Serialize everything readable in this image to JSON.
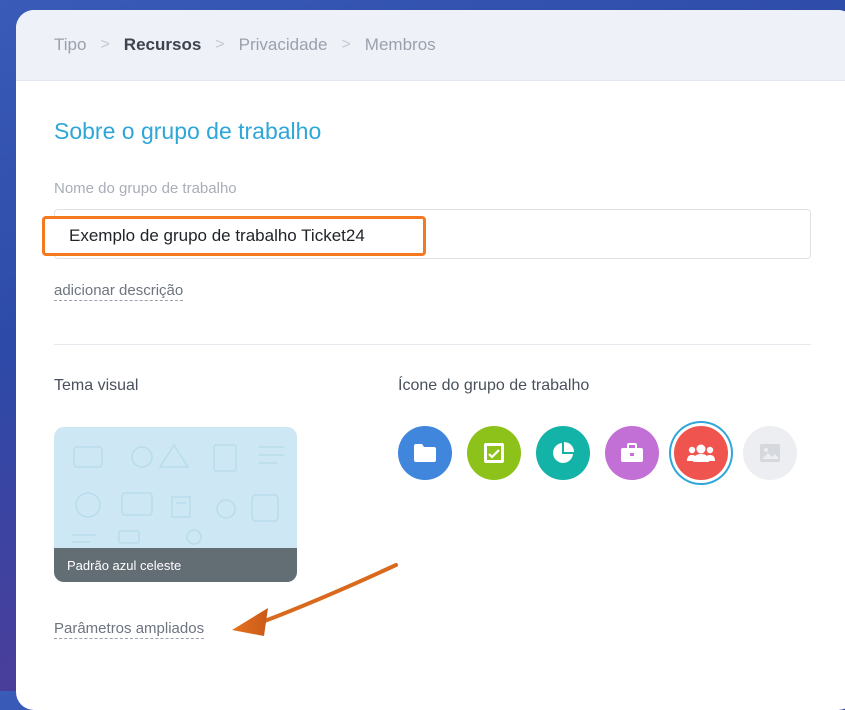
{
  "breadcrumb": [
    {
      "label": "Tipo",
      "active": false
    },
    {
      "label": "Recursos",
      "active": true
    },
    {
      "label": "Privacidade",
      "active": false
    },
    {
      "label": "Membros",
      "active": false
    }
  ],
  "breadcrumb_separator": ">",
  "form": {
    "title": "Sobre o grupo de trabalho",
    "name_label": "Nome do grupo de trabalho",
    "name_value": "Exemplo de grupo de trabalho Ticket24",
    "add_description": "adicionar descrição"
  },
  "theme": {
    "label": "Tema visual",
    "selected_name": "Padrão azul celeste"
  },
  "icons_section": {
    "label": "Ícone do grupo de trabalho",
    "icons": [
      {
        "name": "folder-icon",
        "color": "#3f86dc",
        "selected": false
      },
      {
        "name": "checklist-icon",
        "color": "#8cc21a",
        "selected": false
      },
      {
        "name": "pie-chart-icon",
        "color": "#13b3a8",
        "selected": false
      },
      {
        "name": "briefcase-icon",
        "color": "#c270d6",
        "selected": false
      },
      {
        "name": "users-icon",
        "color": "#f0544f",
        "selected": true
      },
      {
        "name": "image-icon",
        "color": "#eceef1",
        "selected": false
      }
    ]
  },
  "advanced_params": "Parâmetros ampliados",
  "colors": {
    "accent": "#2fa6d8",
    "highlight": "#f57a1f"
  }
}
